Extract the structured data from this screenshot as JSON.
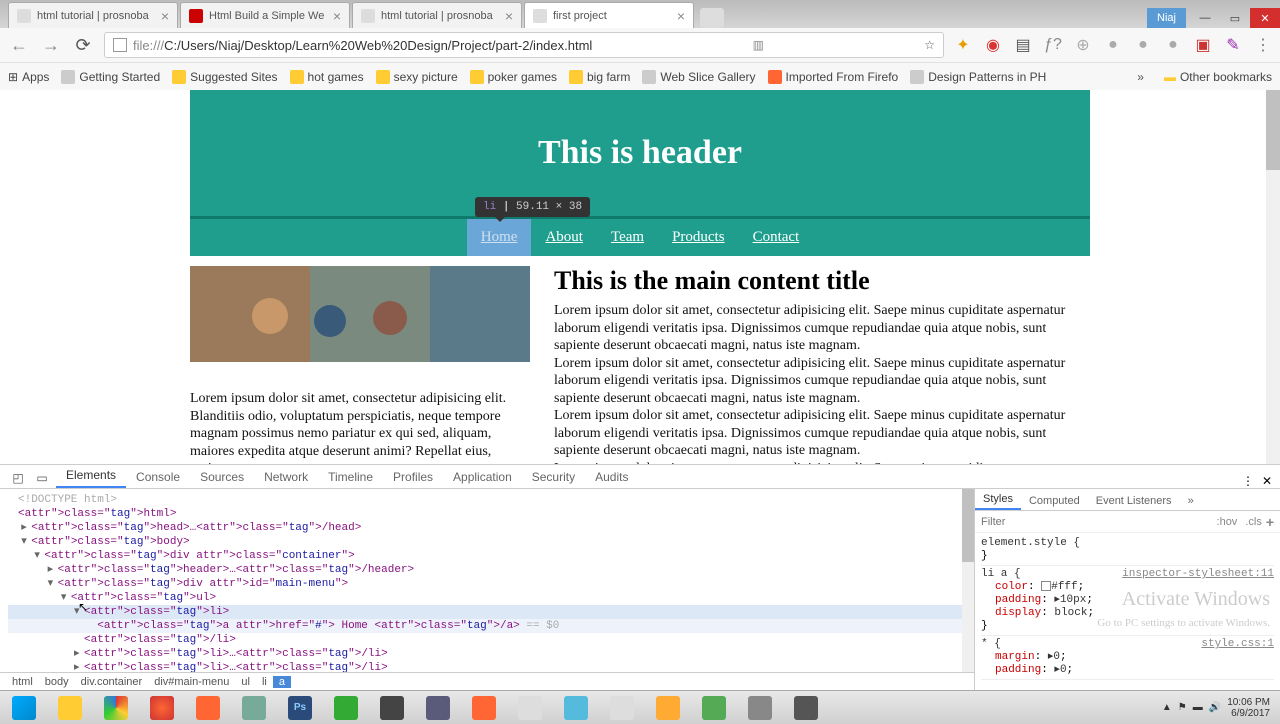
{
  "tabs": [
    {
      "title": "html tutorial | prosnoba"
    },
    {
      "title": "Html Build a Simple We"
    },
    {
      "title": "html tutorial | prosnoba"
    },
    {
      "title": "first project"
    }
  ],
  "user_badge": "Niaj",
  "url": {
    "proto": "file:///",
    "path": "C:/Users/Niaj/Desktop/Learn%20Web%20Design/Project/part-2/index.html"
  },
  "bookmarks": [
    "Apps",
    "Getting Started",
    "Suggested Sites",
    "hot games",
    "sexy picture",
    "poker games",
    "big farm",
    "Web Slice Gallery",
    "Imported From Firefo",
    "Design Patterns in PH"
  ],
  "other_bookmarks": "Other bookmarks",
  "page": {
    "header": "This is header",
    "nav": [
      "Home",
      "About",
      "Team",
      "Products",
      "Contact"
    ],
    "side_text": "Lorem ipsum dolor sit amet, consectetur adipisicing elit. Blanditiis odio, voluptatum perspiciatis, neque tempore magnam possimus nemo pariatur ex qui sed, aliquam, maiores expedita atque deserunt animi? Repellat eius, pariatur.",
    "main_title": "This is the main content title",
    "main_text": "Lorem ipsum dolor sit amet, consectetur adipisicing elit. Saepe minus cupiditate aspernatur laborum eligendi veritatis ipsa. Dignissimos cumque repudiandae quia atque nobis, sunt sapiente deserunt obcaecati magni, natus iste magnam.\nLorem ipsum dolor sit amet, consectetur adipisicing elit. Saepe minus cupiditate aspernatur laborum eligendi veritatis ipsa. Dignissimos cumque repudiandae quia atque nobis, sunt sapiente deserunt obcaecati magni, natus iste magnam.\nLorem ipsum dolor sit amet, consectetur adipisicing elit. Saepe minus cupiditate aspernatur laborum eligendi veritatis ipsa. Dignissimos cumque repudiandae quia atque nobis, sunt sapiente deserunt obcaecati magni, natus iste magnam.\nLorem ipsum dolor sit amet, consectetur adipisicing elit. Saepe minus cupiditate"
  },
  "tooltip": {
    "tag": "li",
    "dims": "59.11 × 38"
  },
  "devtools": {
    "panels": [
      "Elements",
      "Console",
      "Sources",
      "Network",
      "Timeline",
      "Profiles",
      "Application",
      "Security",
      "Audits"
    ],
    "crumbs": [
      "html",
      "body",
      "div.container",
      "div#main-menu",
      "ul",
      "li",
      "a"
    ],
    "dom": [
      {
        "indent": 0,
        "tri": "",
        "html": "<!DOCTYPE html>",
        "cls": "gray"
      },
      {
        "indent": 0,
        "tri": "",
        "html": "<html>"
      },
      {
        "indent": 1,
        "tri": "▸",
        "html": "<head>…</head>"
      },
      {
        "indent": 1,
        "tri": "▾",
        "html": "<body>"
      },
      {
        "indent": 2,
        "tri": "▾",
        "html": "<div class=\"container\">"
      },
      {
        "indent": 3,
        "tri": "▸",
        "html": "<header>…</header>"
      },
      {
        "indent": 3,
        "tri": "▾",
        "html": "<div id=\"main-menu\">"
      },
      {
        "indent": 4,
        "tri": "▾",
        "html": "<ul>"
      },
      {
        "indent": 5,
        "tri": "▾",
        "html": "<li>",
        "sel": true
      },
      {
        "indent": 6,
        "tri": "",
        "html": "<a href=\"#\"> Home </a> == $0",
        "hov": true
      },
      {
        "indent": 5,
        "tri": "",
        "html": "</li>"
      },
      {
        "indent": 5,
        "tri": "▸",
        "html": "<li>…</li>"
      },
      {
        "indent": 5,
        "tri": "▸",
        "html": "<li>…</li>"
      }
    ],
    "styles_tabs": [
      "Styles",
      "Computed",
      "Event Listeners"
    ],
    "filter_placeholder": "Filter",
    "hov": ":hov",
    "cls": ".cls",
    "rules": [
      {
        "sel": "element.style {",
        "props": [],
        "close": "}"
      },
      {
        "sel": "li a {",
        "src": "inspector-stylesheet:11",
        "props": [
          {
            "p": "color",
            "v": "#fff",
            "swatch": true
          },
          {
            "p": "padding",
            "v": "▸10px"
          },
          {
            "p": "display",
            "v": "block"
          }
        ],
        "close": "}"
      },
      {
        "sel": "* {",
        "src": "style.css:1",
        "props": [
          {
            "p": "margin",
            "v": "▸0"
          },
          {
            "p": "padding",
            "v": "▸0"
          }
        ]
      }
    ],
    "watermark": "Activate Windows",
    "watermark2": "Go to PC settings to activate Windows."
  },
  "tray": {
    "time": "10:06 PM",
    "date": "6/9/2017"
  }
}
